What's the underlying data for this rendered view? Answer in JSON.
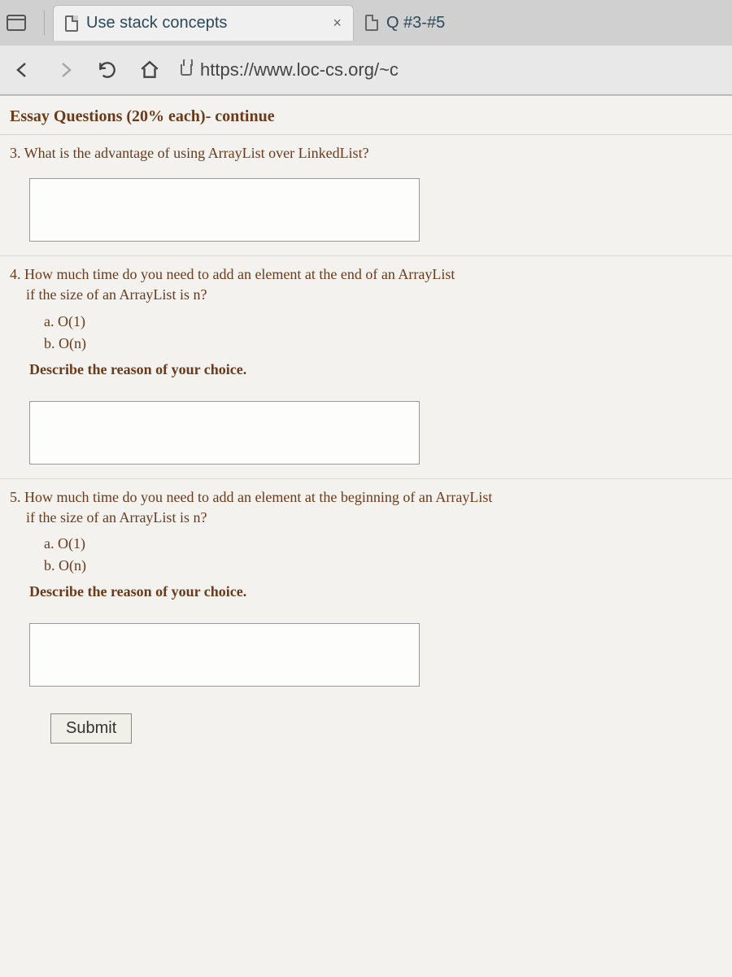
{
  "tabs": {
    "active": {
      "title": "Use stack concepts",
      "close": "×"
    },
    "inactive": {
      "title": "Q #3-#5"
    }
  },
  "address": {
    "url": "https://www.loc-cs.org/~c"
  },
  "heading": "Essay Questions (20% each)- continue",
  "q3": {
    "text": "3. What is the advantage of using ArrayList over LinkedList?"
  },
  "q4": {
    "line1": "4. How much time do you need to add an element at the end of an ArrayList",
    "line2": "if the size of an ArrayList is n?",
    "optA": "a. O(1)",
    "optB": "b. O(n)",
    "describe": "Describe the reason of your choice."
  },
  "q5": {
    "line1": "5. How much time do you need to add an element at the beginning of an ArrayList",
    "line2": "if the size of an ArrayList is n?",
    "optA": "a. O(1)",
    "optB": "b. O(n)",
    "describe": "Describe the reason of your choice."
  },
  "submit": "Submit"
}
